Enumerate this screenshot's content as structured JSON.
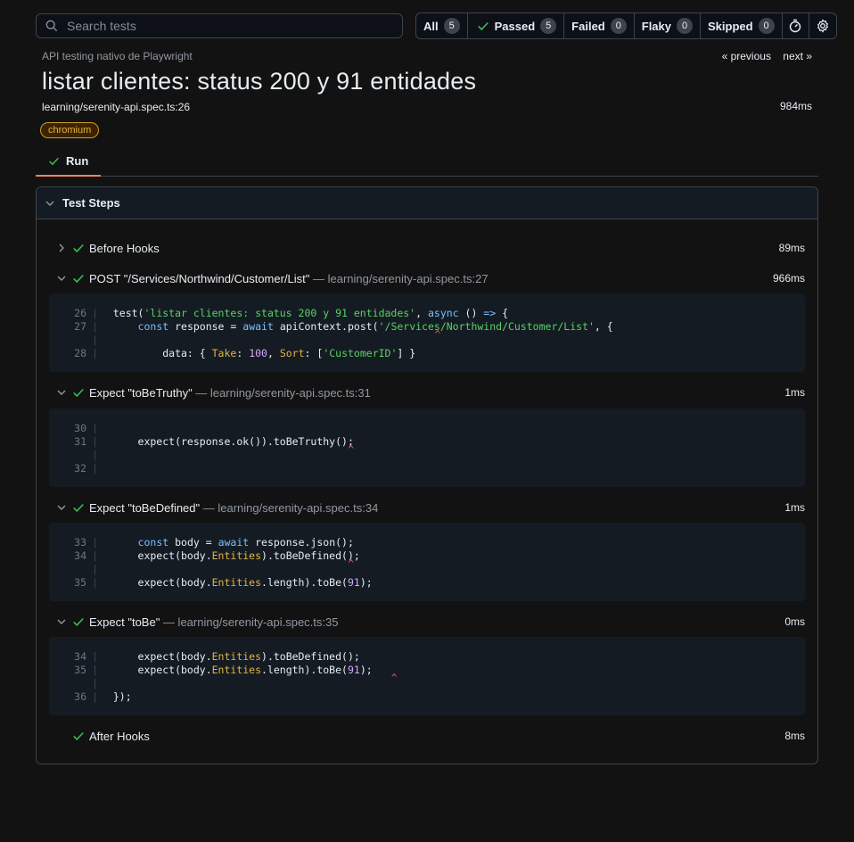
{
  "search": {
    "placeholder": "Search tests"
  },
  "filters": [
    {
      "label": "All",
      "count": "5"
    },
    {
      "label": "Passed",
      "count": "5"
    },
    {
      "label": "Failed",
      "count": "0"
    },
    {
      "label": "Flaky",
      "count": "0"
    },
    {
      "label": "Skipped",
      "count": "0"
    }
  ],
  "header": {
    "subtitle": "API testing nativo de Playwright",
    "prev": "« previous",
    "next": "next »",
    "title": "listar clientes: status 200 y 91 entidades",
    "location": "learning/serenity-api.spec.ts:26",
    "duration": "984ms",
    "project": "chromium"
  },
  "tabs": {
    "run": "Run"
  },
  "panel": {
    "title": "Test Steps"
  },
  "steps": [
    {
      "label": "Before Hooks",
      "loc": "",
      "dur": "89ms"
    },
    {
      "label": "POST \"/Services/Northwind/Customer/List\"",
      "loc": " — learning/serenity-api.spec.ts:27",
      "dur": "966ms"
    },
    {
      "label": "Expect \"toBeTruthy\"",
      "loc": " — learning/serenity-api.spec.ts:31",
      "dur": "1ms"
    },
    {
      "label": "Expect \"toBeDefined\"",
      "loc": " — learning/serenity-api.spec.ts:34",
      "dur": "1ms"
    },
    {
      "label": "Expect \"toBe\"",
      "loc": " — learning/serenity-api.spec.ts:35",
      "dur": "0ms"
    },
    {
      "label": "After Hooks",
      "loc": "",
      "dur": "8ms"
    }
  ],
  "code": {
    "c1": [
      {
        "ln": "26",
        "src": "  test(<s>'listar clientes: status 200 y 91 entidades'</s>, <k>async</k> () <k>=></k> {"
      },
      {
        "ln": "27",
        "src": "      <k>const</k> response = <k>await</k> apiContext.post(<s>'/Services/Northwind/Customer/List'</s>, {"
      },
      {
        "ln": "",
        "src": ""
      },
      {
        "ln": "28",
        "src": "          data: { <p>Take</p>: <n>100</n>, <p>Sort</p>: [<s>'CustomerID'</s>] }"
      }
    ],
    "c2": [
      {
        "ln": "30",
        "src": ""
      },
      {
        "ln": "31",
        "src": "      expect(response.ok()).toBeTruthy();"
      },
      {
        "ln": "",
        "src": ""
      },
      {
        "ln": "32",
        "src": ""
      }
    ],
    "c3": [
      {
        "ln": "33",
        "src": "      <k>const</k> body = <k>await</k> response.json();"
      },
      {
        "ln": "34",
        "src": "      expect(body.<p>Entities</p>).toBeDefined();"
      },
      {
        "ln": "",
        "src": ""
      },
      {
        "ln": "35",
        "src": "      expect(body.<p>Entities</p>.length).toBe(<n>91</n>);"
      }
    ],
    "c4": [
      {
        "ln": "34",
        "src": "      expect(body.<p>Entities</p>).toBeDefined();"
      },
      {
        "ln": "35",
        "src": "      expect(body.<p>Entities</p>.length).toBe(<n>91</n>);"
      },
      {
        "ln": "",
        "src": ""
      },
      {
        "ln": "36",
        "src": "  });"
      }
    ],
    "caret": "^"
  },
  "colors": {
    "accent": "#f78166",
    "pass": "#3fb950",
    "caret": "#f85149",
    "badge": "#d29922"
  },
  "icons": [
    "search-icon",
    "check-icon",
    "clock-icon",
    "gear-icon",
    "chevron-down-icon",
    "chevron-right-icon"
  ]
}
